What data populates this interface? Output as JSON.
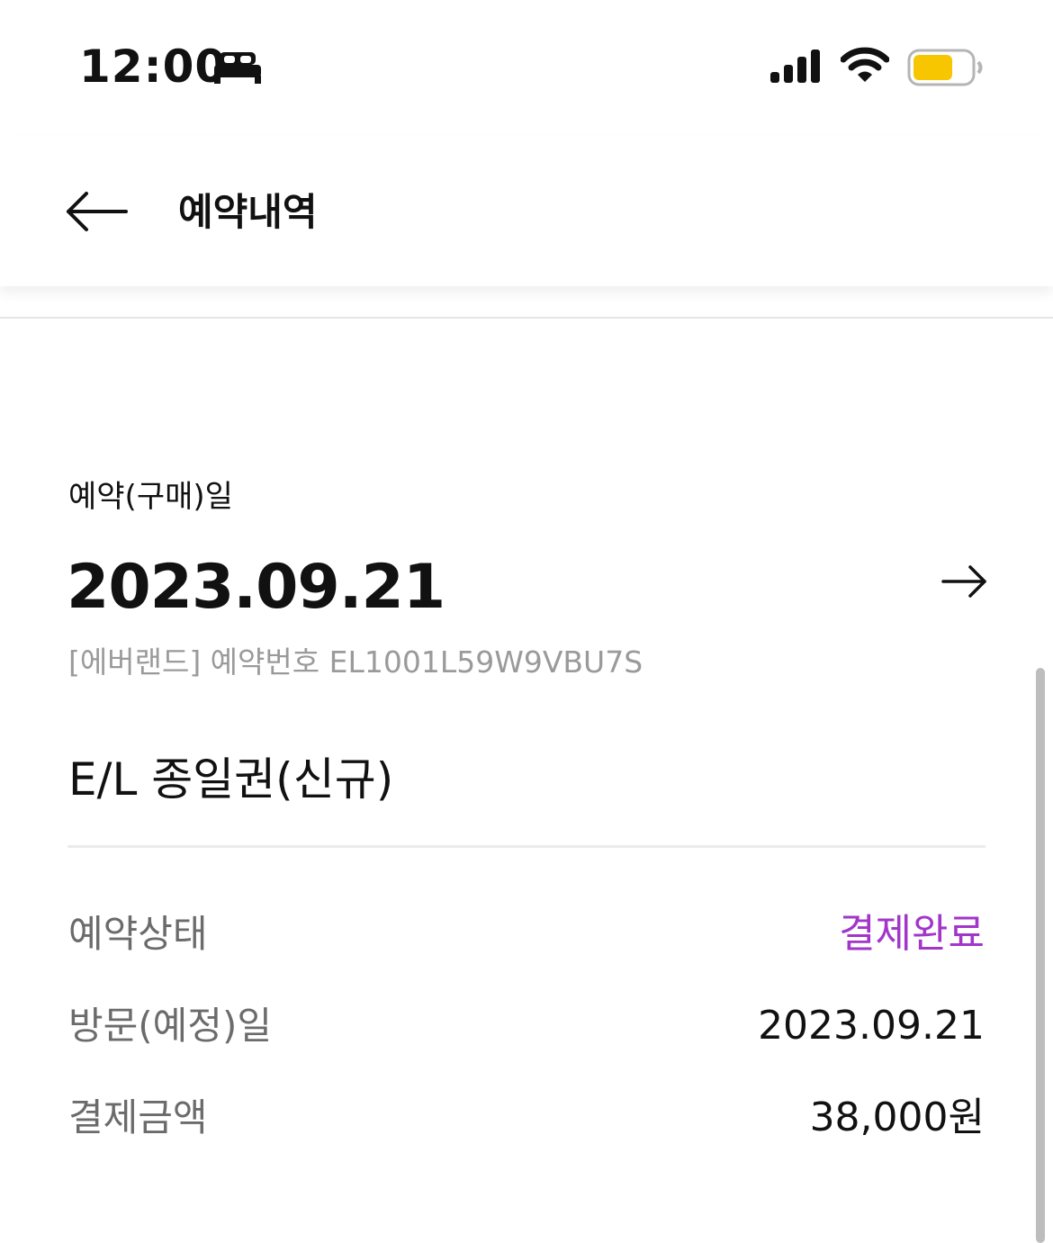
{
  "status_bar": {
    "time": "12:00",
    "battery_color": "#F7C600"
  },
  "header": {
    "title": "예약내역"
  },
  "reservation": {
    "date_label": "예약(구매)일",
    "purchase_date": "2023.09.21",
    "reservation_number": "[에버랜드] 예약번호 EL1001L59W9VBU7S",
    "product_name": "E/L 종일권(신규)",
    "rows": [
      {
        "label": "예약상태",
        "value": "결제완료"
      },
      {
        "label": "방문(예정)일",
        "value": "2023.09.21"
      },
      {
        "label": "결제금액",
        "value": "38,000원"
      }
    ]
  },
  "colors": {
    "status_accent": "#A236C9",
    "secondary_text": "#6B6B6B",
    "muted_text": "#9A9A9A"
  }
}
